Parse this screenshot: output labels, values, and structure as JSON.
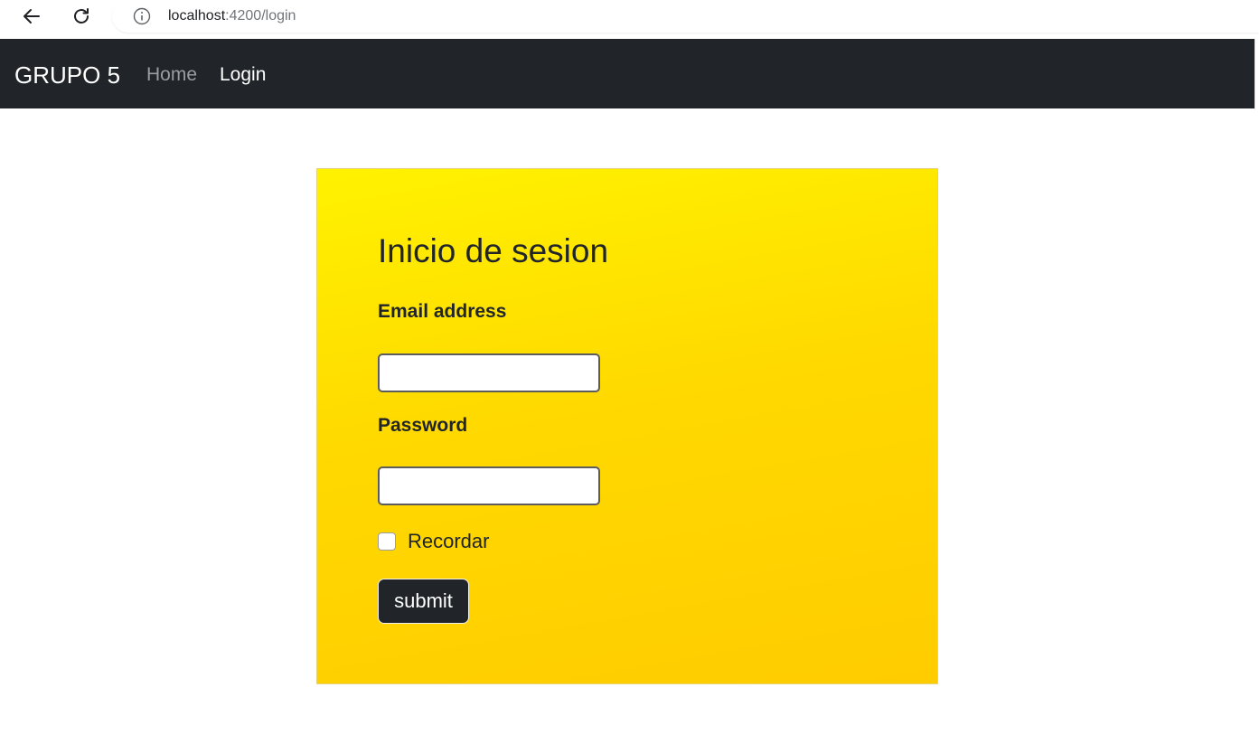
{
  "browser": {
    "url_host": "localhost",
    "url_path": ":4200/login",
    "back_icon": "arrow-left-icon",
    "reload_icon": "reload-icon",
    "info_icon": "info-icon"
  },
  "navbar": {
    "brand": "GRUPO 5",
    "links": [
      {
        "label": "Home",
        "active": false
      },
      {
        "label": "Login",
        "active": true
      }
    ],
    "background": "#212529"
  },
  "login": {
    "title": "Inicio de sesion",
    "email_label": "Email address",
    "email_value": "",
    "password_label": "Password",
    "password_value": "",
    "remember_label": "Recordar",
    "remember_checked": false,
    "submit_label": "submit",
    "gradient_top": "#fff200",
    "gradient_bottom": "#ffcc00"
  }
}
